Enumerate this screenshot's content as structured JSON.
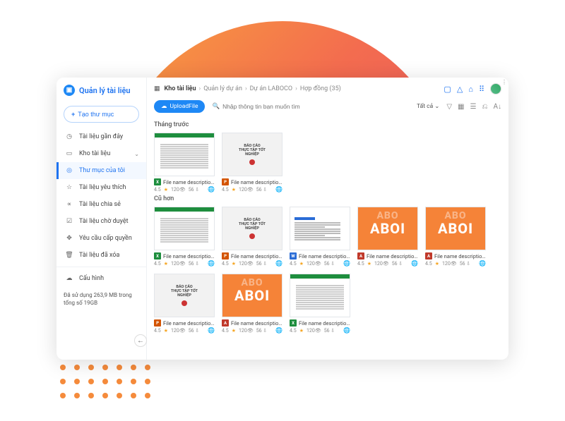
{
  "app": {
    "title": "Quản lý tài liệu"
  },
  "sidebar": {
    "new_folder": "Tạo thư mục",
    "items": [
      {
        "label": "Tài liệu gần đây"
      },
      {
        "label": "Kho  tài liệu",
        "expandable": true
      },
      {
        "label": "Thư mục  của tôi",
        "active": true
      },
      {
        "label": "Tài liệu yêu thích"
      },
      {
        "label": "Tài liệu chia sẻ"
      },
      {
        "label": "Tài liệu chờ duyệt"
      },
      {
        "label": "Yêu cầu cấp quyền"
      },
      {
        "label": "Tài liệu đã xóa"
      }
    ],
    "config_label": "Cấu hình",
    "storage": "Đã sử dụng 263,9 MB trong tổng số 19GB"
  },
  "breadcrumb": {
    "root": "Kho tài liệu",
    "parts": [
      "Quản lý dự án",
      "Dự án LABOCO",
      "Hợp đồng (35)"
    ]
  },
  "toolbar": {
    "upload": "UploadFile",
    "search_placeholder": "Nhập thông tin bạn muốn tìm",
    "filter": "Tất cả"
  },
  "sections": [
    {
      "title": "Tháng trước",
      "files": [
        {
          "thumb": "excel",
          "ftype": "x",
          "name": "File name description...",
          "rating": "4.5",
          "views": "120",
          "downloads": "56"
        },
        {
          "thumb": "report",
          "ftype": "p",
          "name": "File name description...",
          "rating": "4.5",
          "views": "120",
          "downloads": "56",
          "menu": true
        }
      ]
    },
    {
      "title": "Cũ hơn",
      "files": [
        {
          "thumb": "excel",
          "ftype": "x",
          "name": "File name description...",
          "rating": "4.5",
          "views": "120",
          "downloads": "56"
        },
        {
          "thumb": "report",
          "ftype": "p",
          "name": "File name description...",
          "rating": "4.5",
          "views": "120",
          "downloads": "56"
        },
        {
          "thumb": "doc",
          "ftype": "w",
          "name": "File name description...",
          "rating": "4.5",
          "views": "120",
          "downloads": "56"
        },
        {
          "thumb": "orange",
          "ftype": "pdf",
          "name": "File name description...",
          "rating": "4.5",
          "views": "120",
          "downloads": "56"
        },
        {
          "thumb": "orange",
          "ftype": "pdf",
          "name": "File name description...",
          "rating": "4.5",
          "views": "120",
          "downloads": "56"
        },
        {
          "thumb": "report",
          "ftype": "p",
          "name": "File name description...",
          "rating": "4.5",
          "views": "120",
          "downloads": "56"
        },
        {
          "thumb": "orange",
          "ftype": "pdf",
          "name": "File name description...",
          "rating": "4.5",
          "views": "120",
          "downloads": "56"
        },
        {
          "thumb": "excel",
          "ftype": "x",
          "name": "File name description...",
          "rating": "4.5",
          "views": "120",
          "downloads": "56"
        }
      ]
    }
  ],
  "report_text": {
    "l1": "BÁO CÁO",
    "l2": "THỰC TẬP TỐT",
    "l3": "NGHIỆP"
  },
  "orange_text": "ABO"
}
